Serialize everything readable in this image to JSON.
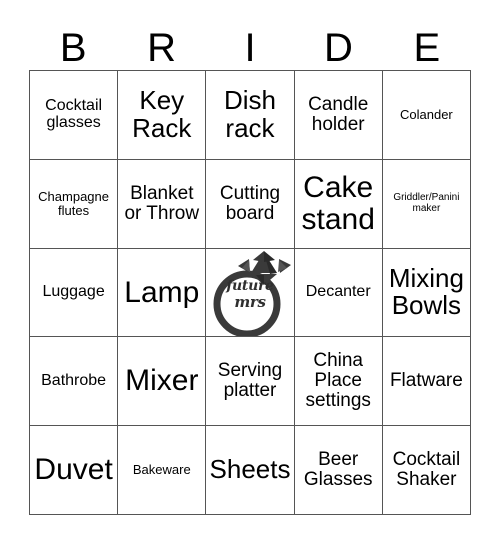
{
  "header": {
    "letters": [
      "B",
      "R",
      "I",
      "D",
      "E"
    ]
  },
  "grid": {
    "rows": [
      [
        {
          "label": "Cocktail glasses",
          "size": "sm"
        },
        {
          "label": "Key Rack",
          "size": "xl"
        },
        {
          "label": "Dish rack",
          "size": "xl"
        },
        {
          "label": "Candle holder",
          "size": "md"
        },
        {
          "label": "Colander",
          "size": "xs"
        }
      ],
      [
        {
          "label": "Champagne flutes",
          "size": "xs"
        },
        {
          "label": "Blanket or Throw",
          "size": "md"
        },
        {
          "label": "Cutting board",
          "size": "md"
        },
        {
          "label": "Cake stand",
          "size": "xxl"
        },
        {
          "label": "Griddler/Panini maker",
          "size": "xxs"
        }
      ],
      [
        {
          "label": "Luggage",
          "size": "sm"
        },
        {
          "label": "Lamp",
          "size": "xxl"
        },
        {
          "label": "",
          "size": "sm",
          "free": true,
          "icon": "diamond-ring-icon",
          "script_line1": "future",
          "script_line2": "mrs"
        },
        {
          "label": "Decanter",
          "size": "sm"
        },
        {
          "label": "Mixing Bowls",
          "size": "xl"
        }
      ],
      [
        {
          "label": "Bathrobe",
          "size": "sm"
        },
        {
          "label": "Mixer",
          "size": "xxl"
        },
        {
          "label": "Serving platter",
          "size": "md"
        },
        {
          "label": "China Place settings",
          "size": "md"
        },
        {
          "label": "Flatware",
          "size": "md"
        }
      ],
      [
        {
          "label": "Duvet",
          "size": "xxl"
        },
        {
          "label": "Bakeware",
          "size": "xs"
        },
        {
          "label": "Sheets",
          "size": "xl"
        },
        {
          "label": "Beer Glasses",
          "size": "md"
        },
        {
          "label": "Cocktail Shaker",
          "size": "md"
        }
      ]
    ]
  },
  "colors": {
    "grid_line": "#555555",
    "text": "#000000",
    "ring": "#3a3a3a",
    "background": "#ffffff"
  }
}
